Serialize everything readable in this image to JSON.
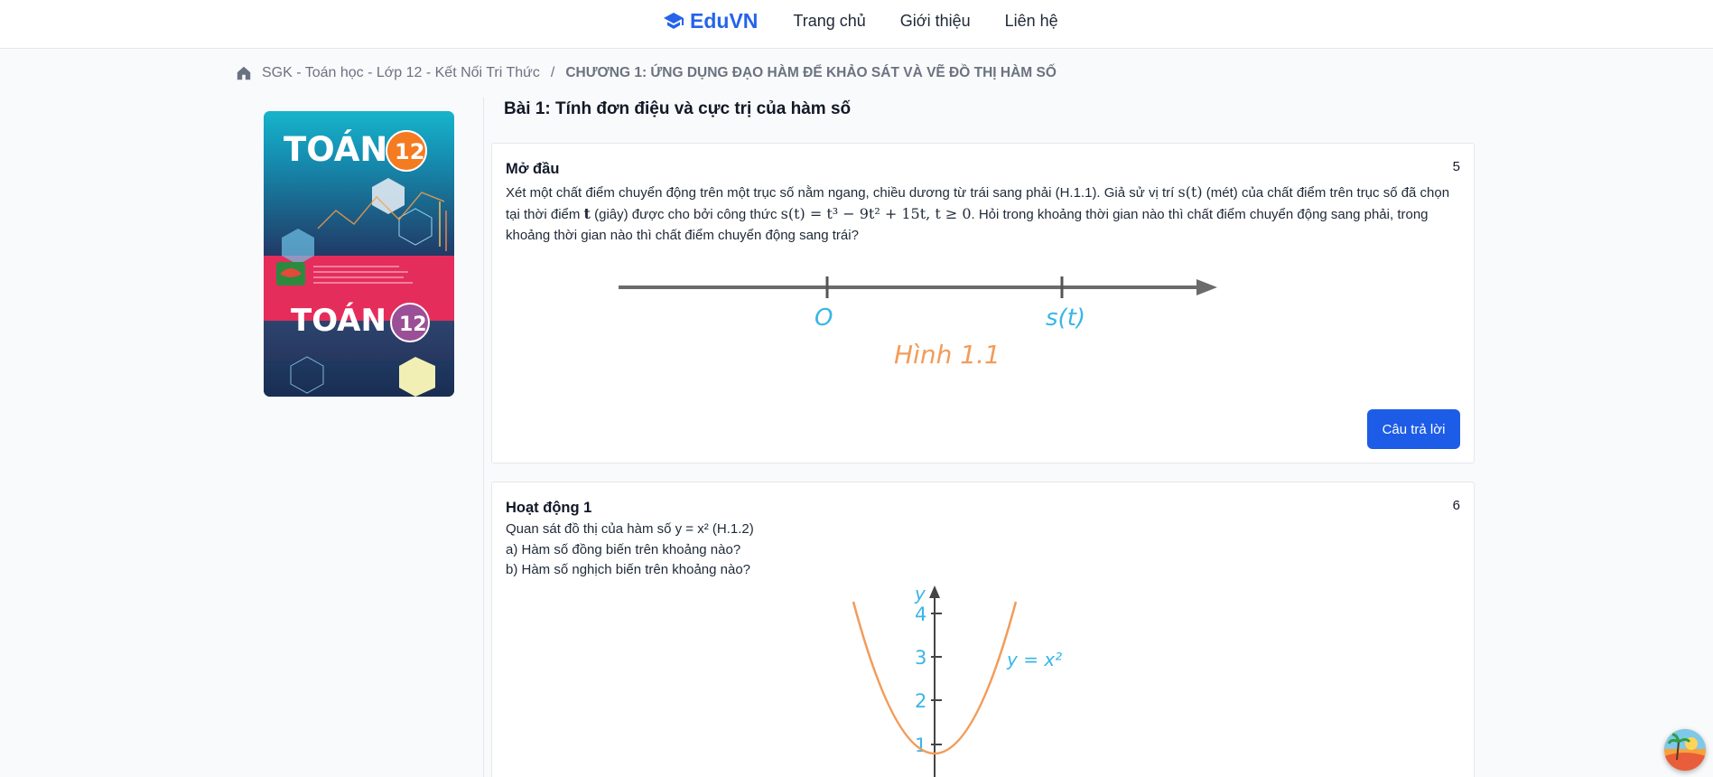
{
  "header": {
    "logo_text": "EduVN",
    "nav": [
      "Trang chủ",
      "Giới thiệu",
      "Liên hệ"
    ]
  },
  "breadcrumb": {
    "book": "SGK - Toán học - Lớp 12 - Kết Nối Tri Thức",
    "separator": "/",
    "chapter": "CHƯƠNG 1: ỨNG DỤNG ĐẠO HÀM ĐỂ KHẢO SÁT VÀ VẼ ĐỒ THỊ HÀM SỐ"
  },
  "cover": {
    "title_top": "TOÁN",
    "title_bottom": "TOÁN",
    "grade": "12"
  },
  "lesson": {
    "title": "Bài 1: Tính đơn điệu và cực trị của hàm số"
  },
  "cards": [
    {
      "title": "Mở đầu",
      "number": "5",
      "text_1": "Xét một chất điểm chuyển động trên một trục số nằm ngang, chiều dương từ trái sang phải (H.1.1). Giả sử vị trí ",
      "math_1": "s(t)",
      "text_2": " (mét) của chất điểm trên trục số đã chọn tại thời điểm ",
      "math_2": "t",
      "text_3": " (giây) được cho bởi công thức ",
      "math_3": "s(t) = t³ − 9t² + 15t, t ≥ 0",
      "text_4": ". Hỏi trong khoảng thời gian nào thì chất điểm chuyển động sang phải, trong khoảng thời gian nào thì chất điểm chuyển động sang trái?",
      "figure": {
        "origin_label": "O",
        "point_label": "s(t)",
        "caption": "Hình 1.1"
      },
      "button_label": "Câu trả lời"
    },
    {
      "title": "Hoạt động 1",
      "number": "6",
      "lines": [
        "Quan sát đồ thị của hàm số y = x² (H.1.2)",
        "a) Hàm số đồng biến trên khoảng nào?",
        "b) Hàm số nghịch biến trên khoảng nào?"
      ],
      "figure": {
        "y_axis_label": "y",
        "ticks": [
          "4",
          "3",
          "2",
          "1"
        ],
        "curve_label": "y = x²"
      }
    }
  ],
  "colors": {
    "brand": "#2563eb",
    "button": "#1d5ce6",
    "figure_blue": "#38b6e6",
    "figure_orange": "#f29c5a"
  }
}
